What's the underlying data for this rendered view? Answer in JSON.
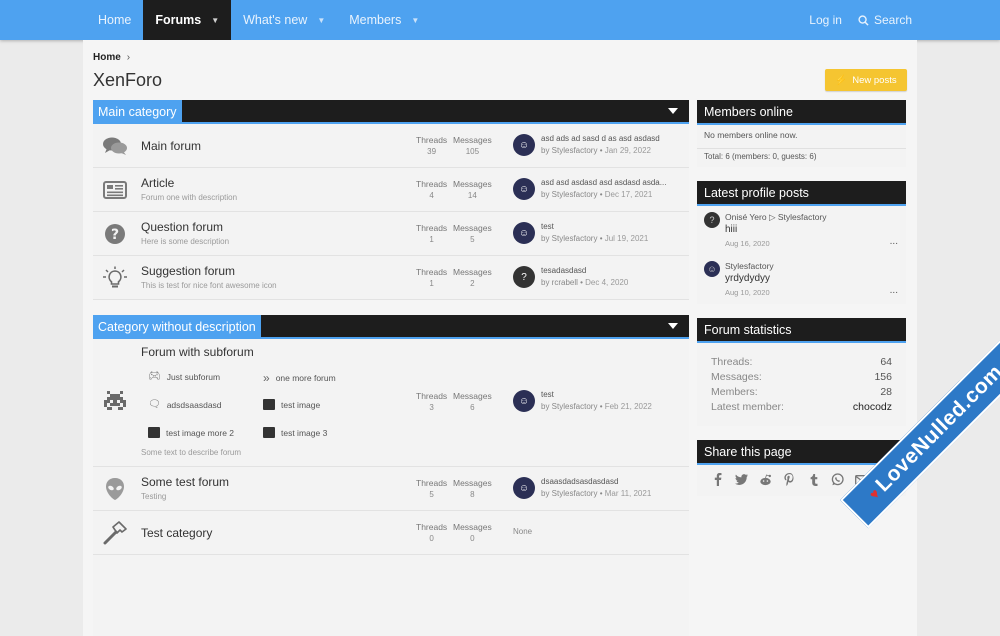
{
  "nav": {
    "items": [
      {
        "label": "Home",
        "has_caret": false,
        "active": false
      },
      {
        "label": "Forums",
        "has_caret": true,
        "active": true
      },
      {
        "label": "What's new",
        "has_caret": true,
        "active": false
      },
      {
        "label": "Members",
        "has_caret": true,
        "active": false
      }
    ],
    "login": "Log in",
    "search": "Search"
  },
  "breadcrumb": {
    "home": "Home"
  },
  "page_title": "XenForo",
  "new_posts": "New posts",
  "categories": [
    {
      "title": "Main category",
      "nodes": [
        {
          "title": "Main forum",
          "desc": "",
          "icon": "comments-icon",
          "threads_label": "Threads",
          "threads": "39",
          "messages_label": "Messages",
          "messages": "105",
          "last_title": "asd ads ad sasd d as asd asdasd",
          "last_by": "by Stylesfactory",
          "last_date": "Jan 29, 2022"
        },
        {
          "title": "Article",
          "desc": "Forum one with description",
          "icon": "newspaper-icon",
          "threads_label": "Threads",
          "threads": "4",
          "messages_label": "Messages",
          "messages": "14",
          "last_title": "asd asd asdasd asd asdasd asda...",
          "last_by": "by Stylesfactory",
          "last_date": "Dec 17, 2021"
        },
        {
          "title": "Question forum",
          "desc": "Here is some description",
          "icon": "question-circle-icon",
          "threads_label": "Threads",
          "threads": "1",
          "messages_label": "Messages",
          "messages": "5",
          "last_title": "test",
          "last_by": "by Stylesfactory",
          "last_date": "Jul 19, 2021"
        },
        {
          "title": "Suggestion forum",
          "desc": "This is test for nice font awesome icon",
          "icon": "lightbulb-icon",
          "threads_label": "Threads",
          "threads": "1",
          "messages_label": "Messages",
          "messages": "2",
          "last_title": "tesadasdasd",
          "last_by": "by rcrabell",
          "last_date": "Dec 4, 2020"
        }
      ]
    },
    {
      "title": "Category without description",
      "nodes": [
        {
          "title": "Forum with subforum",
          "desc": "Some text to describe forum",
          "icon": "space-invader-icon",
          "threads_label": "Threads",
          "threads": "3",
          "messages_label": "Messages",
          "messages": "6",
          "last_title": "test",
          "last_by": "by Stylesfactory",
          "last_date": "Feb 21, 2022",
          "subforums": [
            "Just subforum",
            "one more forum",
            "adsdsaasdasd",
            "test image",
            "test image more 2",
            "test image 3"
          ]
        },
        {
          "title": "Some test forum",
          "desc": "Testing",
          "icon": "alien-icon",
          "threads_label": "Threads",
          "threads": "5",
          "messages_label": "Messages",
          "messages": "8",
          "last_title": "dsaasdadsasdasdasd",
          "last_by": "by Stylesfactory",
          "last_date": "Mar 11, 2021"
        },
        {
          "title": "Test category",
          "desc": "",
          "icon": "hammer-icon",
          "threads_label": "Threads",
          "threads": "0",
          "messages_label": "Messages",
          "messages": "0",
          "last_none": "None"
        }
      ]
    }
  ],
  "sidebar": {
    "members_online": {
      "title": "Members online",
      "none": "No members online now.",
      "total": "Total: 6 (members: 0, guests: 6)"
    },
    "profile_posts": {
      "title": "Latest profile posts",
      "posts": [
        {
          "who": "Onisé Yero ▷ Stylesfactory",
          "msg": "hiii",
          "when": "Aug 16, 2020",
          "avatar": "?"
        },
        {
          "who": "Stylesfactory",
          "msg": "yrdydydyy",
          "when": "Aug 10, 2020",
          "avatar": ""
        }
      ],
      "more": "..."
    },
    "forum_stats": {
      "title": "Forum statistics",
      "rows": [
        {
          "label": "Threads:",
          "value": "64"
        },
        {
          "label": "Messages:",
          "value": "156"
        },
        {
          "label": "Members:",
          "value": "28"
        },
        {
          "label": "Latest member:",
          "value": "chocodz"
        }
      ]
    },
    "share": {
      "title": "Share this page",
      "icons": [
        "facebook-icon",
        "twitter-icon",
        "reddit-icon",
        "pinterest-icon",
        "tumblr-icon",
        "whatsapp-icon",
        "email-icon",
        "link-icon"
      ]
    }
  },
  "watermark": "LoveNulled.com",
  "colors": {
    "accent": "#4ea2f0",
    "header_dark": "#1d1d1d",
    "button": "#f5c531"
  }
}
